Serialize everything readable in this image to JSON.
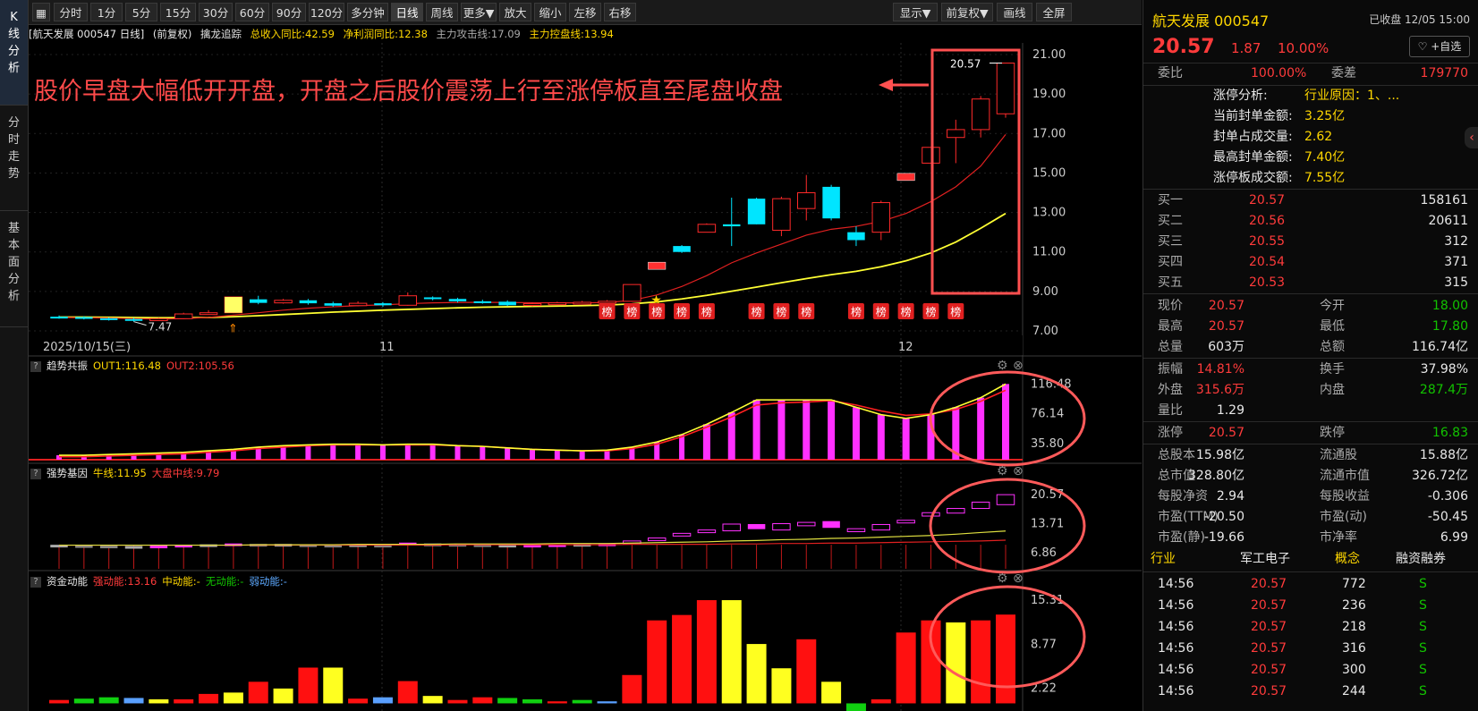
{
  "nav": {
    "tabs": [
      {
        "label": "K线分析",
        "active": true
      },
      {
        "label": "分时走势",
        "active": false
      },
      {
        "label": "基本面分析",
        "active": false
      }
    ]
  },
  "toolbar": {
    "buttons": [
      "分时",
      "1分",
      "5分",
      "15分",
      "30分",
      "60分",
      "90分",
      "120分",
      "多分钟",
      "日线",
      "周线",
      "更多▼",
      "放大",
      "缩小",
      "左移",
      "右移"
    ],
    "active": "日线",
    "right_buttons": [
      "显示▼",
      "前复权▼",
      "画线",
      "全屏"
    ]
  },
  "info": {
    "title": "[航天发展 000547 日线]",
    "adjust": "(前复权)",
    "indicator": "擒龙追踪",
    "rev": "总收入同比:42.59",
    "profit": "净利润同比:12.38",
    "attack": "主力攻击线:17.09",
    "control": "主力控盘线:13.94"
  },
  "annotation": "股价早盘大幅低开开盘，开盘之后股价震荡上行至涨停板直至尾盘收盘",
  "badge_label": "榜",
  "colors": {
    "up": "#ff2a2a",
    "down": "#00e5ff",
    "ma1": "#e02020",
    "ma2": "#ffff33",
    "accent": "#ff4444"
  },
  "chart_data": [
    {
      "type": "candlestick",
      "title": "航天发展 000547 日线",
      "ylim": [
        7.0,
        21.5
      ],
      "yticks": [
        "21.00",
        "19.00",
        "17.00",
        "15.00",
        "13.00",
        "11.00",
        "9.00",
        "7.00"
      ],
      "xlabels": [
        "2025/10/15(三)",
        "11",
        "12"
      ],
      "low_label": "7.47",
      "high_label": "20.57",
      "candles": [
        {
          "o": 7.72,
          "c": 7.7,
          "h": 7.78,
          "l": 7.62
        },
        {
          "o": 7.7,
          "c": 7.64,
          "h": 7.74,
          "l": 7.58
        },
        {
          "o": 7.64,
          "c": 7.6,
          "h": 7.68,
          "l": 7.52
        },
        {
          "o": 7.6,
          "c": 7.52,
          "h": 7.66,
          "l": 7.47
        },
        {
          "o": 7.52,
          "c": 7.62,
          "h": 7.66,
          "l": 7.5
        },
        {
          "o": 7.62,
          "c": 7.86,
          "h": 7.92,
          "l": 7.6
        },
        {
          "o": 7.86,
          "c": 7.92,
          "h": 8.05,
          "l": 7.84
        },
        {
          "o": 7.92,
          "c": 8.72,
          "h": 8.72,
          "l": 7.9
        },
        {
          "o": 8.6,
          "c": 8.42,
          "h": 8.78,
          "l": 8.35
        },
        {
          "o": 8.42,
          "c": 8.55,
          "h": 8.62,
          "l": 8.38
        },
        {
          "o": 8.55,
          "c": 8.4,
          "h": 8.62,
          "l": 8.33
        },
        {
          "o": 8.4,
          "c": 8.28,
          "h": 8.48,
          "l": 8.22
        },
        {
          "o": 8.28,
          "c": 8.4,
          "h": 8.5,
          "l": 8.25
        },
        {
          "o": 8.4,
          "c": 8.3,
          "h": 8.46,
          "l": 8.22
        },
        {
          "o": 8.3,
          "c": 8.78,
          "h": 8.95,
          "l": 8.28
        },
        {
          "o": 8.7,
          "c": 8.62,
          "h": 8.75,
          "l": 8.55
        },
        {
          "o": 8.62,
          "c": 8.5,
          "h": 8.68,
          "l": 8.44
        },
        {
          "o": 8.5,
          "c": 8.42,
          "h": 8.58,
          "l": 8.38
        },
        {
          "o": 8.48,
          "c": 8.3,
          "h": 8.55,
          "l": 8.26
        },
        {
          "o": 8.3,
          "c": 8.38,
          "h": 8.45,
          "l": 8.25
        },
        {
          "o": 8.38,
          "c": 8.42,
          "h": 8.48,
          "l": 8.32
        },
        {
          "o": 8.4,
          "c": 8.45,
          "h": 8.52,
          "l": 8.36
        },
        {
          "o": 8.45,
          "c": 8.5,
          "h": 8.56,
          "l": 8.4
        },
        {
          "o": 8.5,
          "c": 9.35,
          "h": 9.35,
          "l": 8.48
        },
        {
          "o": 10.3,
          "c": 10.3,
          "h": 10.3,
          "l": 10.3
        },
        {
          "o": 11.3,
          "c": 11.0,
          "h": 11.35,
          "l": 10.95
        },
        {
          "o": 12.0,
          "c": 12.4,
          "h": 12.45,
          "l": 12.0
        },
        {
          "o": 12.4,
          "c": 12.3,
          "h": 13.75,
          "l": 11.3
        },
        {
          "o": 13.7,
          "c": 12.4,
          "h": 13.75,
          "l": 12.4
        },
        {
          "o": 12.1,
          "c": 13.7,
          "h": 13.8,
          "l": 11.8
        },
        {
          "o": 13.2,
          "c": 14.0,
          "h": 14.9,
          "l": 12.6
        },
        {
          "o": 14.3,
          "c": 12.7,
          "h": 14.4,
          "l": 12.6
        },
        {
          "o": 12.0,
          "c": 11.6,
          "h": 12.3,
          "l": 11.3
        },
        {
          "o": 12.0,
          "c": 13.5,
          "h": 13.6,
          "l": 11.6
        },
        {
          "o": 14.8,
          "c": 14.8,
          "h": 14.8,
          "l": 14.8
        },
        {
          "o": 15.5,
          "c": 16.3,
          "h": 16.3,
          "l": 15.5
        },
        {
          "o": 16.8,
          "c": 17.2,
          "h": 17.7,
          "l": 15.5
        },
        {
          "o": 17.2,
          "c": 18.75,
          "h": 18.9,
          "l": 16.8
        },
        {
          "o": 18.0,
          "c": 20.57,
          "h": 20.57,
          "l": 17.8
        }
      ],
      "ma1": [
        7.68,
        7.67,
        7.65,
        7.62,
        7.6,
        7.62,
        7.68,
        7.8,
        7.92,
        8.05,
        8.15,
        8.22,
        8.28,
        8.32,
        8.38,
        8.42,
        8.44,
        8.45,
        8.44,
        8.43,
        8.42,
        8.42,
        8.44,
        8.55,
        8.82,
        9.25,
        9.8,
        10.45,
        10.95,
        11.4,
        11.85,
        12.15,
        12.3,
        12.55,
        12.95,
        13.55,
        14.3,
        15.35,
        16.95
      ],
      "ma2": [
        7.7,
        7.7,
        7.69,
        7.68,
        7.67,
        7.67,
        7.68,
        7.72,
        7.77,
        7.83,
        7.89,
        7.95,
        8.0,
        8.05,
        8.09,
        8.13,
        8.17,
        8.2,
        8.22,
        8.24,
        8.26,
        8.28,
        8.31,
        8.37,
        8.47,
        8.62,
        8.8,
        9.01,
        9.22,
        9.44,
        9.65,
        9.85,
        10.02,
        10.25,
        10.55,
        10.95,
        11.5,
        12.2,
        12.95
      ]
    },
    {
      "type": "bar",
      "title": "趋势共振",
      "series": [
        {
          "name": "OUT1:116.48"
        },
        {
          "name": "OUT2:105.56"
        }
      ],
      "ylim": [
        14,
        123
      ],
      "yticks": [
        "116.48",
        "76.14",
        "35.80"
      ],
      "values": [
        20,
        20,
        21,
        22,
        23,
        24,
        26,
        28,
        31,
        33,
        34,
        35,
        35,
        34,
        35,
        35,
        33,
        32,
        30,
        28,
        27,
        26,
        27,
        31,
        38,
        48,
        62,
        78,
        95,
        95,
        95,
        95,
        85,
        75,
        70,
        75,
        85,
        98,
        116.48
      ],
      "out2": [
        18,
        18,
        19,
        20,
        21,
        22,
        24,
        26,
        29,
        31,
        33,
        34,
        34,
        34,
        34,
        34,
        33,
        32,
        30,
        28,
        27,
        26,
        26,
        29,
        35,
        45,
        58,
        72,
        88,
        91,
        92,
        94,
        88,
        80,
        74,
        76,
        82,
        93,
        108
      ]
    },
    {
      "type": "candlestick",
      "title": "强势基因",
      "series": [
        {
          "name": "牛线:11.95"
        },
        {
          "name": "大盘中线:9.79"
        }
      ],
      "ylim": [
        3.0,
        22.5
      ],
      "yticks": [
        "20.57",
        "13.71",
        "6.86"
      ],
      "candles": [
        {
          "o": 8.7,
          "c": 8.5
        },
        {
          "o": 8.6,
          "c": 8.4
        },
        {
          "o": 8.5,
          "c": 8.2
        },
        {
          "o": 8.4,
          "c": 8.1
        },
        {
          "o": 8.3,
          "c": 8.5
        },
        {
          "o": 8.4,
          "c": 8.7
        },
        {
          "o": 8.5,
          "c": 8.8
        },
        {
          "o": 8.6,
          "c": 9.0
        },
        {
          "o": 8.9,
          "c": 8.6
        },
        {
          "o": 8.7,
          "c": 8.9
        },
        {
          "o": 8.8,
          "c": 8.6
        },
        {
          "o": 8.7,
          "c": 8.5
        },
        {
          "o": 8.6,
          "c": 8.8
        },
        {
          "o": 8.7,
          "c": 8.5
        },
        {
          "o": 8.6,
          "c": 9.2
        },
        {
          "o": 9.0,
          "c": 8.8
        },
        {
          "o": 8.9,
          "c": 8.7
        },
        {
          "o": 8.8,
          "c": 8.6
        },
        {
          "o": 8.7,
          "c": 8.5
        },
        {
          "o": 8.6,
          "c": 8.7
        },
        {
          "o": 8.6,
          "c": 8.8
        },
        {
          "o": 8.7,
          "c": 8.9
        },
        {
          "o": 8.8,
          "c": 9.0
        },
        {
          "o": 8.9,
          "c": 9.6
        },
        {
          "o": 10.3,
          "c": 10.3
        },
        {
          "o": 11.0,
          "c": 11.4
        },
        {
          "o": 11.8,
          "c": 12.2
        },
        {
          "o": 12.0,
          "c": 13.6
        },
        {
          "o": 13.6,
          "c": 12.4
        },
        {
          "o": 12.2,
          "c": 13.7
        },
        {
          "o": 13.2,
          "c": 14.0
        },
        {
          "o": 14.3,
          "c": 12.7
        },
        {
          "o": 11.8,
          "c": 12.5
        },
        {
          "o": 12.2,
          "c": 13.5
        },
        {
          "o": 14.5,
          "c": 14.5
        },
        {
          "o": 15.5,
          "c": 16.3
        },
        {
          "o": 16.2,
          "c": 17.3
        },
        {
          "o": 17.3,
          "c": 18.8
        },
        {
          "o": 18.2,
          "c": 20.57
        }
      ],
      "bull": [
        8.6,
        8.6,
        8.6,
        8.6,
        8.6,
        8.6,
        8.6,
        8.6,
        8.7,
        8.7,
        8.7,
        8.7,
        8.8,
        8.8,
        8.8,
        8.8,
        8.9,
        8.9,
        8.9,
        8.9,
        9.0,
        9.0,
        9.0,
        9.1,
        9.2,
        9.3,
        9.4,
        9.6,
        9.7,
        9.9,
        10.0,
        10.2,
        10.3,
        10.5,
        10.7,
        10.9,
        11.2,
        11.6,
        11.95
      ],
      "market": [
        8.6,
        8.6,
        8.6,
        8.6,
        8.6,
        8.6,
        8.6,
        8.6,
        8.6,
        8.6,
        8.6,
        8.6,
        8.6,
        8.6,
        8.6,
        8.6,
        8.7,
        8.7,
        8.7,
        8.7,
        8.7,
        8.7,
        8.7,
        8.8,
        8.8,
        8.8,
        8.8,
        8.9,
        8.9,
        9.0,
        9.0,
        9.1,
        9.1,
        9.2,
        9.3,
        9.4,
        9.5,
        9.6,
        9.79
      ]
    },
    {
      "type": "bar",
      "title": "资金动能",
      "series": [
        {
          "name": "强动能:13.16"
        },
        {
          "name": "中动能:-"
        },
        {
          "name": "无动能:-"
        },
        {
          "name": "弱动能:-"
        }
      ],
      "ylim": [
        -1,
        16.5
      ],
      "yticks": [
        "15.31",
        "8.77",
        "2.22"
      ],
      "values": [
        0.5,
        0.7,
        0.9,
        0.8,
        0.6,
        0.6,
        1.4,
        1.6,
        3.2,
        2.2,
        5.3,
        5.3,
        0.7,
        0.9,
        3.3,
        1.1,
        0.5,
        0.9,
        0.8,
        0.6,
        0.3,
        0.5,
        0.3,
        4.2,
        12.3,
        13.1,
        15.3,
        15.3,
        8.8,
        5.2,
        9.5,
        3.2,
        -3.2,
        0.6,
        10.5,
        12.3,
        12.0,
        12.3,
        13.16
      ],
      "colors": [
        "red",
        "green",
        "green",
        "blue",
        "yellow",
        "red",
        "red",
        "yellow",
        "red",
        "yellow",
        "red",
        "yellow",
        "red",
        "blue",
        "red",
        "yellow",
        "red",
        "red",
        "green",
        "green",
        "red",
        "green",
        "blue",
        "red",
        "red",
        "red",
        "red",
        "yellow",
        "yellow",
        "yellow",
        "red",
        "yellow",
        "green",
        "red",
        "red",
        "red",
        "yellow",
        "red",
        "red"
      ]
    }
  ],
  "panels": {
    "p2_out1_label": "OUT1:116.48",
    "p2_out2_label": "OUT2:105.56",
    "p3_bull_label": "牛线:11.95",
    "p3_market_label": "大盘中线:9.79",
    "p4_strong": "强动能:13.16",
    "p4_mid": "中动能:-",
    "p4_none": "无动能:-",
    "p4_weak": "弱动能:-"
  },
  "quote": {
    "name": "航天发展",
    "code": "000547",
    "status": "已收盘 12/05 15:00",
    "price": "20.57",
    "change": "1.87",
    "pct": "10.00%",
    "follow": "♡ +自选",
    "wb_label": "委比",
    "wb": "100.00%",
    "wc_label": "委差",
    "wc": "179770",
    "zt_rows": [
      {
        "k": "涨停分析:",
        "v": "行业原因：1、..."
      },
      {
        "k": "当前封单金额:",
        "v": "3.25亿"
      },
      {
        "k": "封单占成交量:",
        "v": "2.62"
      },
      {
        "k": "最高封单金额:",
        "v": "7.40亿"
      },
      {
        "k": "涨停板成交额:",
        "v": "7.55亿"
      }
    ],
    "bids": [
      {
        "k": "买一",
        "p": "20.57",
        "v": "158161"
      },
      {
        "k": "买二",
        "p": "20.56",
        "v": "20611"
      },
      {
        "k": "买三",
        "p": "20.55",
        "v": "312"
      },
      {
        "k": "买四",
        "p": "20.54",
        "v": "371"
      },
      {
        "k": "买五",
        "p": "20.53",
        "v": "315"
      }
    ],
    "stats": [
      {
        "k1": "现价",
        "v1": "20.57",
        "c1": "red",
        "k2": "今开",
        "v2": "18.00",
        "c2": "green"
      },
      {
        "k1": "最高",
        "v1": "20.57",
        "c1": "red",
        "k2": "最低",
        "v2": "17.80",
        "c2": "green"
      },
      {
        "k1": "总量",
        "v1": "603万",
        "c1": "white",
        "k2": "总额",
        "v2": "116.74亿",
        "c2": "white"
      },
      {
        "k1": "振幅",
        "v1": "14.81%",
        "c1": "red",
        "k2": "换手",
        "v2": "37.98%",
        "c2": "white"
      },
      {
        "k1": "外盘",
        "v1": "315.6万",
        "c1": "red",
        "k2": "内盘",
        "v2": "287.4万",
        "c2": "green"
      },
      {
        "k1": "量比",
        "v1": "1.29",
        "c1": "white",
        "k2": "",
        "v2": "",
        "c2": "white"
      },
      {
        "k1": "涨停",
        "v1": "20.57",
        "c1": "red",
        "k2": "跌停",
        "v2": "16.83",
        "c2": "green"
      },
      {
        "k1": "总股本",
        "v1": "15.98亿",
        "c1": "white",
        "k2": "流通股",
        "v2": "15.88亿",
        "c2": "white"
      },
      {
        "k1": "总市值",
        "v1": "328.80亿",
        "c1": "white",
        "k2": "流通市值",
        "v2": "326.72亿",
        "c2": "white"
      },
      {
        "k1": "每股净资",
        "v1": "2.94",
        "c1": "white",
        "k2": "每股收益",
        "v2": "-0.306",
        "c2": "white"
      },
      {
        "k1": "市盈(TTM)",
        "v1": "-20.50",
        "c1": "white",
        "k2": "市盈(动)",
        "v2": "-50.45",
        "c2": "white"
      },
      {
        "k1": "市盈(静)",
        "v1": "-19.66",
        "c1": "white",
        "k2": "市净率",
        "v2": "6.99",
        "c2": "white"
      }
    ],
    "tags": [
      "行业",
      "军工电子",
      "概念",
      "融资融券"
    ],
    "ticks": [
      {
        "t": "14:56",
        "p": "20.57",
        "v": "772",
        "s": "S"
      },
      {
        "t": "14:56",
        "p": "20.57",
        "v": "236",
        "s": "S"
      },
      {
        "t": "14:56",
        "p": "20.57",
        "v": "218",
        "s": "S"
      },
      {
        "t": "14:56",
        "p": "20.57",
        "v": "316",
        "s": "S"
      },
      {
        "t": "14:56",
        "p": "20.57",
        "v": "300",
        "s": "S"
      },
      {
        "t": "14:56",
        "p": "20.57",
        "v": "244",
        "s": "S"
      }
    ]
  }
}
